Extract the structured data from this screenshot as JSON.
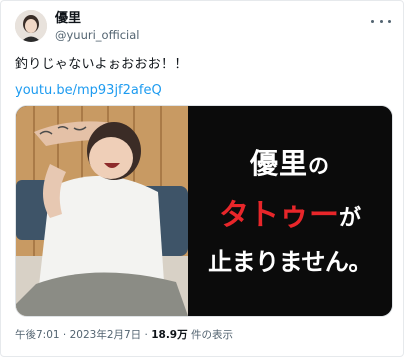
{
  "user": {
    "display_name": "優里",
    "handle": "@yuuri_official"
  },
  "tweet": {
    "text": "釣りじゃないよぉおおお！！",
    "link": "youtu.be/mp93jf2afeQ"
  },
  "media": {
    "overlay_line1_main": "優里",
    "overlay_line1_particle": "の",
    "overlay_line2_main": "タトゥー",
    "overlay_line2_particle": "が",
    "overlay_line3": "止まりません。"
  },
  "meta": {
    "timestamp": "午後7:01 · 2023年2月7日 ·",
    "views": "18.9万",
    "views_label": "件の表示"
  },
  "colors": {
    "link": "#1d9bf0",
    "overlay_red": "#e8262a"
  },
  "icons": [
    "more-icon"
  ]
}
